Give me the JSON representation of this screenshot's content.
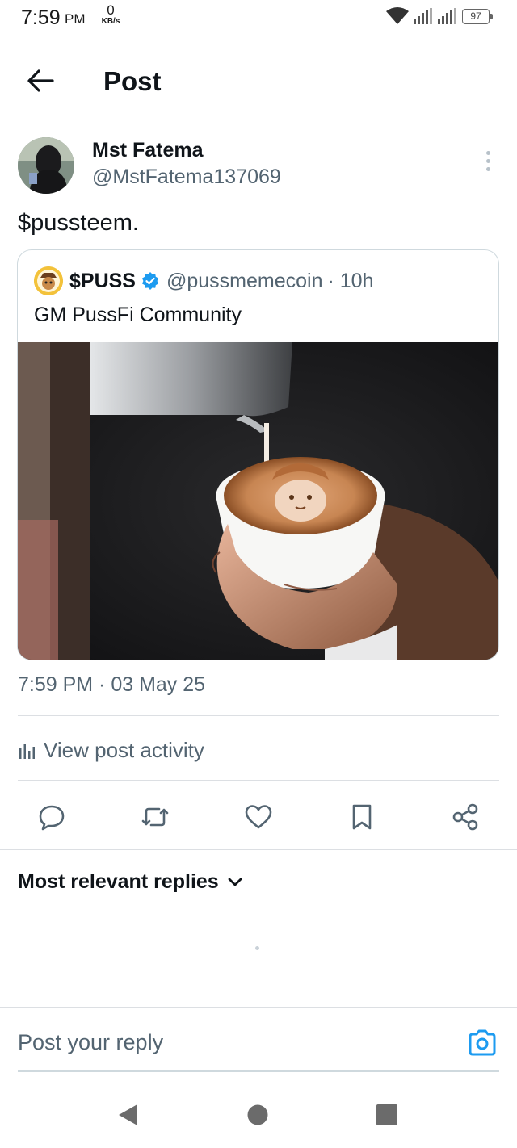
{
  "status_bar": {
    "time": "7:59",
    "ampm": "PM",
    "net_speed_value": "0",
    "net_speed_unit": "KB/s",
    "battery": "97",
    "icons": [
      "wifi-icon",
      "signal-icon",
      "signal-icon",
      "battery-icon"
    ]
  },
  "header": {
    "title": "Post",
    "back_icon": "arrow-left-icon"
  },
  "post": {
    "author_name": "Mst Fatema",
    "author_handle": "@MstFatema137069",
    "text": "$pussteem.",
    "timestamp": "7:59 PM · 03 May 25",
    "view_activity_label": "View post activity",
    "quote": {
      "name": "$PUSS",
      "verified": true,
      "handle": "@pussmemecoin",
      "time": "· 10h",
      "text": "GM PussFi Community",
      "image_description": "latte-art-cat-photo"
    }
  },
  "actions": [
    {
      "name": "reply",
      "icon": "reply-icon"
    },
    {
      "name": "repost",
      "icon": "repost-icon"
    },
    {
      "name": "like",
      "icon": "heart-icon"
    },
    {
      "name": "bookmark",
      "icon": "bookmark-icon"
    },
    {
      "name": "share",
      "icon": "share-icon"
    }
  ],
  "replies": {
    "sort_label": "Most relevant replies"
  },
  "reply_bar": {
    "placeholder": "Post your reply"
  },
  "colors": {
    "text_primary": "#0f1419",
    "text_secondary": "#536471",
    "accent": "#1d9bf0",
    "divider": "#dcdfe3"
  }
}
